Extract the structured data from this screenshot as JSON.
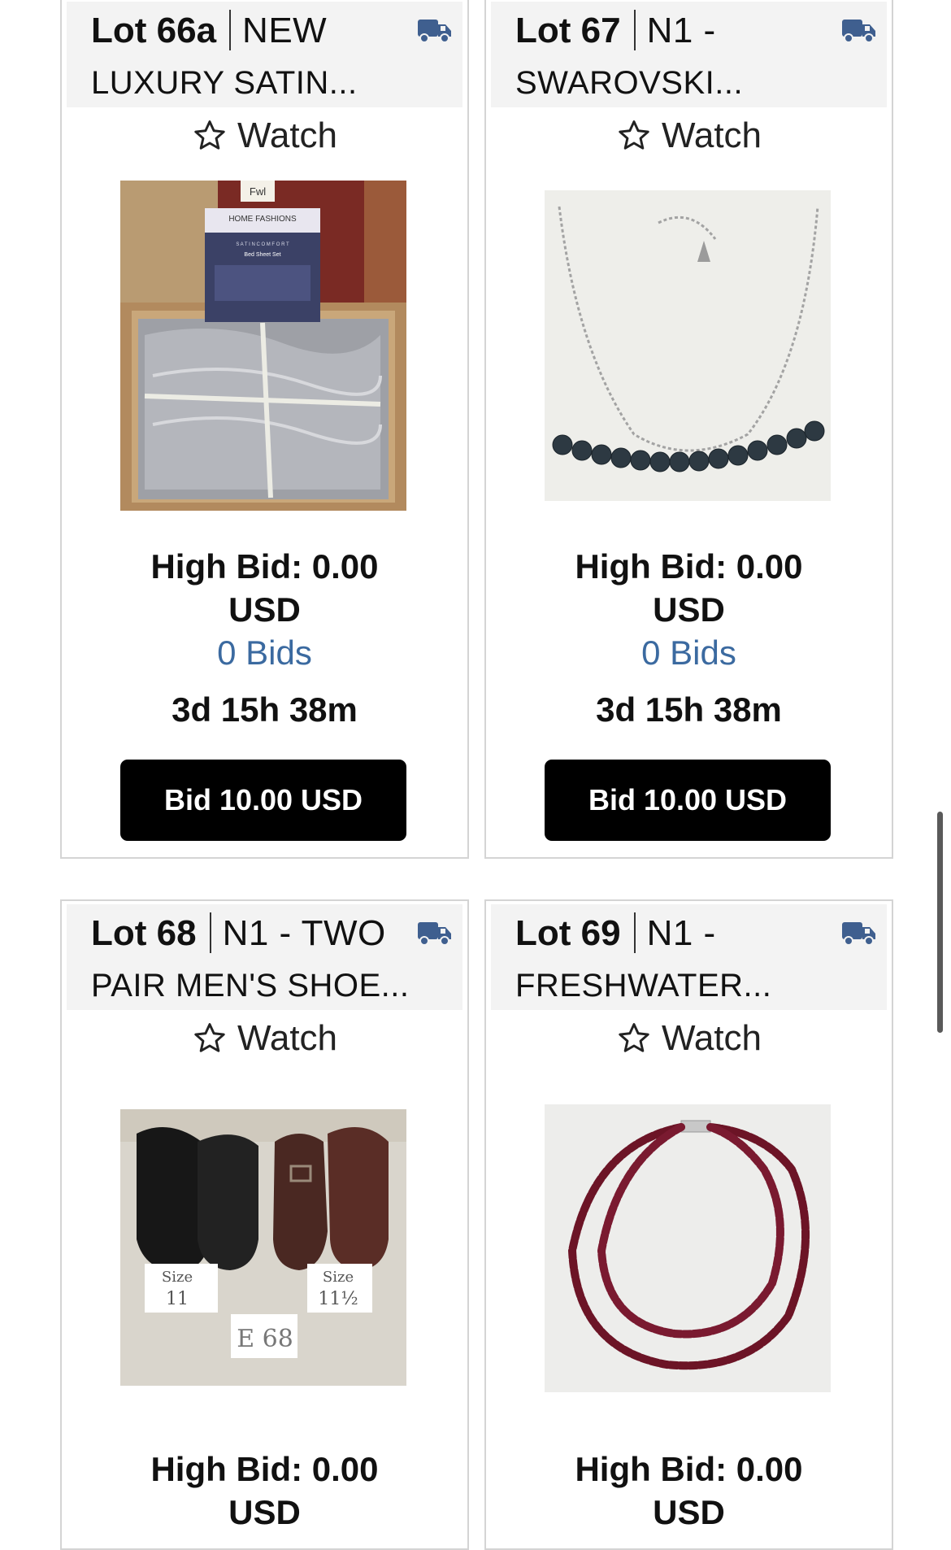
{
  "lots": [
    {
      "lot_number": "Lot 66a",
      "subtitle": "NEW",
      "title": "LUXURY SATIN...",
      "watch_label": "Watch",
      "photo_label": "new-satin-sheet-set-photo",
      "photo_text": {
        "tag": "Fwl",
        "brand": "HOME FASHIONS",
        "line": "S A T I N   C O M F O R T",
        "product": "Bed Sheet Set"
      },
      "high_bid": "High Bid: 0.00",
      "currency": "USD",
      "bids": "0 Bids",
      "time_left": "3d 15h 38m",
      "bid_button": "Bid 10.00 USD"
    },
    {
      "lot_number": "Lot 67",
      "subtitle": "N1 -",
      "title": "SWAROVSKI...",
      "watch_label": "Watch",
      "photo_label": "swarovski-necklace-photo",
      "high_bid": "High Bid: 0.00",
      "currency": "USD",
      "bids": "0 Bids",
      "time_left": "3d 15h 38m",
      "bid_button": "Bid 10.00 USD"
    },
    {
      "lot_number": "Lot 68",
      "subtitle": "N1 - TWO",
      "title": "PAIR MEN'S SHOE...",
      "watch_label": "Watch",
      "photo_label": "mens-shoes-photo",
      "photo_text": {
        "size_left": "Size",
        "size_left_val": "11",
        "size_right": "Size",
        "size_right_val": "11½",
        "lot_tag": "E 68"
      },
      "high_bid": "High Bid: 0.00",
      "currency": "USD"
    },
    {
      "lot_number": "Lot 69",
      "subtitle": "N1 -",
      "title": "FRESHWATER...",
      "watch_label": "Watch",
      "photo_label": "freshwater-pearl-necklace-photo",
      "high_bid": "High Bid: 0.00",
      "currency": "USD"
    }
  ],
  "colors": {
    "card_header_bg": "#f3f3f3",
    "bids_link": "#3b6aa0",
    "shipping_icon": "#3f5f8f",
    "button_bg": "#000000"
  },
  "icons": [
    "shipping-truck-icon",
    "star-outline-icon"
  ]
}
